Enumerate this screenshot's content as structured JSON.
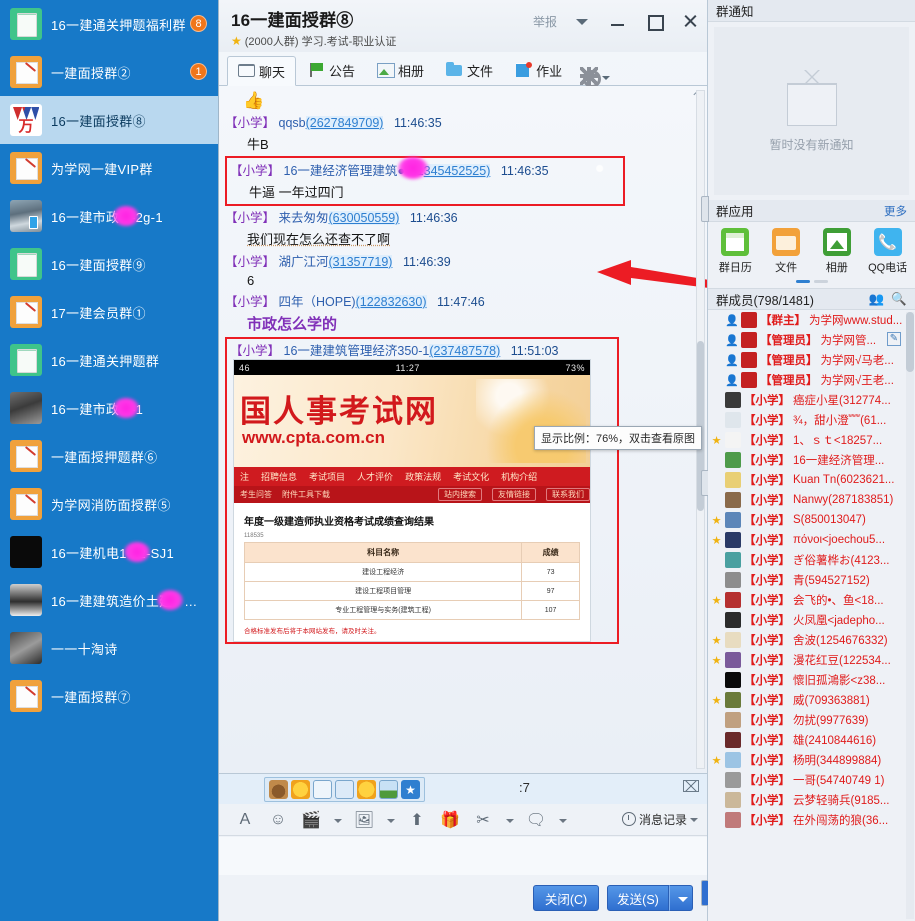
{
  "window": {
    "report_label": "举报",
    "caret_icon": "chevron-down-icon",
    "minimize_icon": "minimize-icon",
    "maximize_icon": "maximize-icon",
    "close_icon": "close-icon"
  },
  "sidebar": {
    "items": [
      {
        "label": "16一建通关押题福利群",
        "badge": "8",
        "avatar": "green-doc"
      },
      {
        "label": "一建面授群②",
        "badge": "1",
        "avatar": "orange-pen"
      },
      {
        "label": "16一建面授群⑧",
        "badge": "",
        "avatar": "wan-logo",
        "active": true
      },
      {
        "label": "为学网一建VIP群",
        "badge": "",
        "avatar": "orange-pen"
      },
      {
        "label": "16一建市政●●-2g-1",
        "badge": "",
        "avatar": "photo-a"
      },
      {
        "label": "16一建面授群⑨",
        "badge": "",
        "avatar": "green-doc"
      },
      {
        "label": "17一建会员群①",
        "badge": "",
        "avatar": "orange-pen"
      },
      {
        "label": "16一建通关押题群",
        "badge": "",
        "avatar": "green-doc"
      },
      {
        "label": "16一建市政●●-1",
        "badge": "",
        "avatar": "photo-b"
      },
      {
        "label": "一建面授押题群⑥",
        "badge": "",
        "avatar": "orange-pen"
      },
      {
        "label": "为学网消防面授群⑤",
        "badge": "",
        "avatar": "orange-pen"
      },
      {
        "label": "16一建机电1●●2-SJ1",
        "badge": "",
        "avatar": "photo-c"
      },
      {
        "label": "16一建建筑造价土建●●（层",
        "badge": "",
        "avatar": "photo-d"
      },
      {
        "label": "一一十淘诗",
        "badge": "",
        "avatar": "photo-e"
      },
      {
        "label": "一建面授群⑦",
        "badge": "",
        "avatar": "orange-pen"
      }
    ]
  },
  "header": {
    "title": "16一建面授群⑧",
    "subtitle": "(2000人群) 学习.考试-职业认证",
    "star_icon": "star-icon",
    "tabs": [
      {
        "label": "聊天",
        "icon": "chat-icon",
        "active": true
      },
      {
        "label": "公告",
        "icon": "flag-icon",
        "active": false
      },
      {
        "label": "相册",
        "icon": "album-icon",
        "active": false
      },
      {
        "label": "文件",
        "icon": "folder-icon",
        "active": false
      },
      {
        "label": "作业",
        "icon": "homework-icon",
        "active": false
      }
    ],
    "settings_icon": "gear-icon"
  },
  "chat": {
    "collapse_icon": "collapse-icon",
    "thumbsup_emoji": "👍",
    "messages": [
      {
        "tag": "【小学】",
        "nick": "qqsb",
        "qq": "(2627849709)",
        "time": "11:46:35",
        "body": "牛B",
        "highlight": false
      },
      {
        "tag": "【小学】",
        "nick": "16一建经济管理建筑●●-1",
        "qq": "345452525)",
        "time": "11:46:35",
        "body": "牛逼      一年过四门",
        "highlight": true
      },
      {
        "tag": "【小学】",
        "nick": "来去匆匆",
        "qq": "(630050559)",
        "time": "11:46:36",
        "body": "我们现在怎么还查不了啊",
        "highlight": false
      },
      {
        "tag": "【小学】",
        "nick": "湖广江河",
        "qq": "(31357719)",
        "time": "11:46:39",
        "body": "6",
        "highlight": false
      },
      {
        "tag": "【小学】",
        "nick": "四年（HOPE)",
        "qq": "(122832630)",
        "time": "11:47:46",
        "body": "市政怎么学的",
        "highlight": false,
        "purple": true
      },
      {
        "tag": "【小学】",
        "nick": "16一建建筑管理经济350-1",
        "qq": "(237487578)",
        "time": "11:51:03",
        "body": "",
        "highlight": true,
        "has_image": true
      }
    ],
    "image": {
      "status_left": "46",
      "status_center": "11:27",
      "status_right": "73%",
      "banner_title": "国人事考试网",
      "banner_url": "www.cpta.com.cn",
      "nav_items": [
        "注",
        "招聘信息",
        "考试项目",
        "人才评价",
        "政策法规",
        "考试文化",
        "机构介绍"
      ],
      "nav2_items": [
        "考生问答",
        "附件工具下载"
      ],
      "nav2_pills": [
        "站内搜索",
        "友情链接",
        "联系我们"
      ],
      "result_title": "年度一级建造师执业资格考试成绩查询结果",
      "result_sub": "118535",
      "table_headers": [
        "科目名称",
        "成绩"
      ],
      "table_rows": [
        [
          "建设工程经济",
          "73"
        ],
        [
          "建设工程项目管理",
          "97"
        ],
        [
          "专业工程管理与实务(建筑工程)",
          "107"
        ]
      ],
      "footnote": "合格标准发布后将于本网站发布，请及时关注。",
      "tooltip": "显示比例：76%，双击查看原图"
    }
  },
  "input": {
    "emoji_popup_icons": [
      "sticker-icon",
      "emoji-add-icon",
      "save-icon",
      "screen-icon",
      "face-icon",
      "picture-icon",
      "favorite-icon"
    ],
    "partial_text": ":7",
    "mail_icon": "mail-icon",
    "toolbar_icons": [
      {
        "name": "font-icon",
        "glyph": "A",
        "caret": false
      },
      {
        "name": "emoji-icon",
        "glyph": "☺",
        "caret": false
      },
      {
        "name": "sticker-icon",
        "glyph": "🎬",
        "caret": true
      },
      {
        "name": "image-icon",
        "glyph": "🖼",
        "caret": true
      },
      {
        "name": "upload-icon",
        "glyph": "⬆",
        "caret": false
      },
      {
        "name": "gift-icon",
        "glyph": "🎁",
        "caret": false
      },
      {
        "name": "scissors-icon",
        "glyph": "✂",
        "caret": true
      },
      {
        "name": "shake-icon",
        "glyph": "🗨",
        "caret": true
      }
    ],
    "history_label": "消息记录",
    "history_icon": "clock-icon",
    "history_caret": "chevron-down-icon",
    "close_button": "关闭(C)",
    "send_button": "发送(S)",
    "send_caret": "chevron-down-icon"
  },
  "rightpanel": {
    "notice_title": "群通知",
    "notice_empty_text": "暂时没有新通知",
    "notice_icon": "board-icon",
    "apps_title": "群应用",
    "apps_more": "更多",
    "apps": [
      {
        "label": "群日历",
        "icon": "calendar-icon"
      },
      {
        "label": "文件",
        "icon": "folder-icon"
      },
      {
        "label": "相册",
        "icon": "album-icon"
      },
      {
        "label": "QQ电话",
        "icon": "phone-icon"
      }
    ],
    "members_title": "群成员(798/1481)",
    "members_icons": [
      "invite-icon",
      "search-icon"
    ],
    "edit_icon": "edit-icon",
    "members": [
      {
        "star": false,
        "role": "【群主】",
        "name": "为学网www.stud...",
        "avatar": "red"
      },
      {
        "star": false,
        "role": "【管理员】",
        "name": "为学网管...",
        "avatar": "red"
      },
      {
        "star": false,
        "role": "【管理员】",
        "name": "为学网√马老...",
        "avatar": "red"
      },
      {
        "star": false,
        "role": "【管理员】",
        "name": "为学网√王老...",
        "avatar": "red"
      },
      {
        "star": false,
        "role": "【小学】",
        "name": "癌症小星(312774...",
        "avatar": "dark"
      },
      {
        "star": false,
        "role": "【小学】",
        "name": "¾，甜小澄﹌(61...",
        "avatar": "pale"
      },
      {
        "star": true,
        "role": "【小学】",
        "name": "1、ｓｔ<18257...",
        "avatar": "white"
      },
      {
        "star": false,
        "role": "【小学】",
        "name": "16一建经济管理...",
        "avatar": "green"
      },
      {
        "star": false,
        "role": "【小学】",
        "name": "Kuan Tn(6023621...",
        "avatar": "yellow"
      },
      {
        "star": false,
        "role": "【小学】",
        "name": "Nanwy(287183851)",
        "avatar": "brown"
      },
      {
        "star": true,
        "role": "【小学】",
        "name": "S(850013047)",
        "avatar": "blue"
      },
      {
        "star": true,
        "role": "【小学】",
        "name": "πόνοι<joechou5...",
        "avatar": "navy"
      },
      {
        "star": false,
        "role": "【小学】",
        "name": "ぎ俗薯桦お(4123...",
        "avatar": "teal"
      },
      {
        "star": false,
        "role": "【小学】",
        "name": "青(594527152)",
        "avatar": "grey"
      },
      {
        "star": true,
        "role": "【小学】",
        "name": "会飞的•、鱼<18...",
        "avatar": "red2"
      },
      {
        "star": false,
        "role": "【小学】",
        "name": "火凤凰<jadepho...",
        "avatar": "dark2"
      },
      {
        "star": true,
        "role": "【小学】",
        "name": "舍波(1254676332)",
        "avatar": "cream"
      },
      {
        "star": true,
        "role": "【小学】",
        "name": "漫花红豆(122534...",
        "avatar": "purple"
      },
      {
        "star": false,
        "role": "【小学】",
        "name": "懷旧孤鴻影<z38...",
        "avatar": "black"
      },
      {
        "star": true,
        "role": "【小学】",
        "name": "威(709363881)",
        "avatar": "olive"
      },
      {
        "star": false,
        "role": "【小学】",
        "name": "勿扰(9977639)",
        "avatar": "tan"
      },
      {
        "star": false,
        "role": "【小学】",
        "name": "雄(2410844616)",
        "avatar": "maroon"
      },
      {
        "star": true,
        "role": "【小学】",
        "name": "杨明(344899884)",
        "avatar": "sky"
      },
      {
        "star": false,
        "role": "【小学】",
        "name": "一哥(54740749 1)",
        "avatar": "grey2"
      },
      {
        "star": false,
        "role": "【小学】",
        "name": "云梦轻骑兵(9185...",
        "avatar": "beige"
      },
      {
        "star": false,
        "role": "【小学】",
        "name": "在外闯荡的狼(36...",
        "avatar": "rose"
      }
    ]
  }
}
